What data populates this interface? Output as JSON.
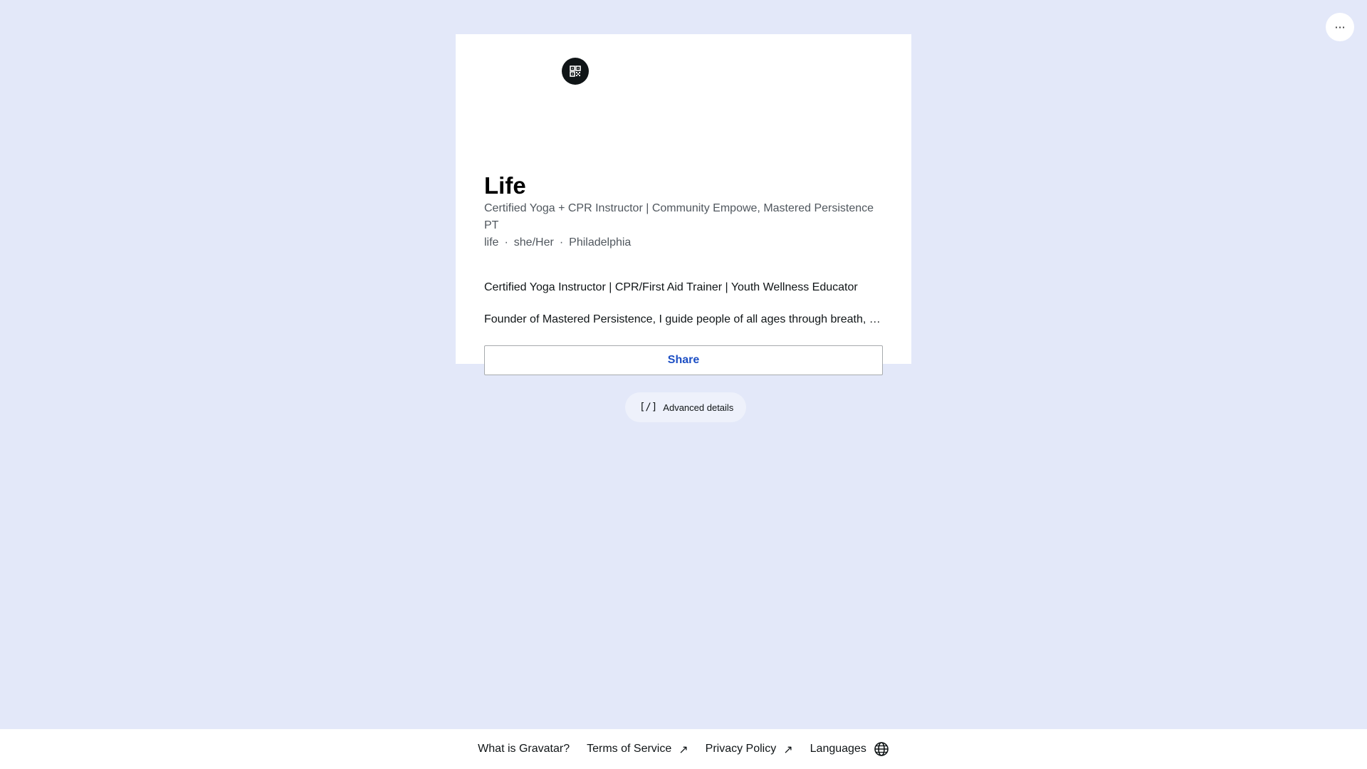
{
  "header": {
    "more_icon": "ellipsis-horizontal-icon",
    "more_label": "···"
  },
  "profile": {
    "qr_icon": "qr-code-icon",
    "name": "Life",
    "meta_line": "Certified Yoga + CPR Instructor | Community Empowe, Mastered Persistence PT",
    "meta_line2": {
      "username": "life",
      "pronouns": "she/Her",
      "location": "Philadelphia"
    },
    "meta_separator": "·",
    "headline": "Certified Yoga Instructor | CPR/First Aid Trainer | Youth Wellness Educator",
    "description": "Founder of Mastered Persistence, I guide people of all ages through breath, bod…",
    "share_label": "Share"
  },
  "advanced": {
    "icon_label": "[/]",
    "label": "Advanced details"
  },
  "footer": {
    "links": [
      {
        "label": "What is Gravatar?"
      },
      {
        "label": "Terms of Service",
        "icon": "external-link-icon"
      },
      {
        "label": "Privacy Policy",
        "icon": "external-link-icon"
      },
      {
        "label": "Languages",
        "icon": "globe-icon"
      }
    ],
    "arrow_glyph": "↗"
  },
  "colors": {
    "background": "#e3e8f9",
    "card": "#ffffff",
    "accent": "#1d4fc4",
    "text": "#101517",
    "muted": "#50575e"
  }
}
